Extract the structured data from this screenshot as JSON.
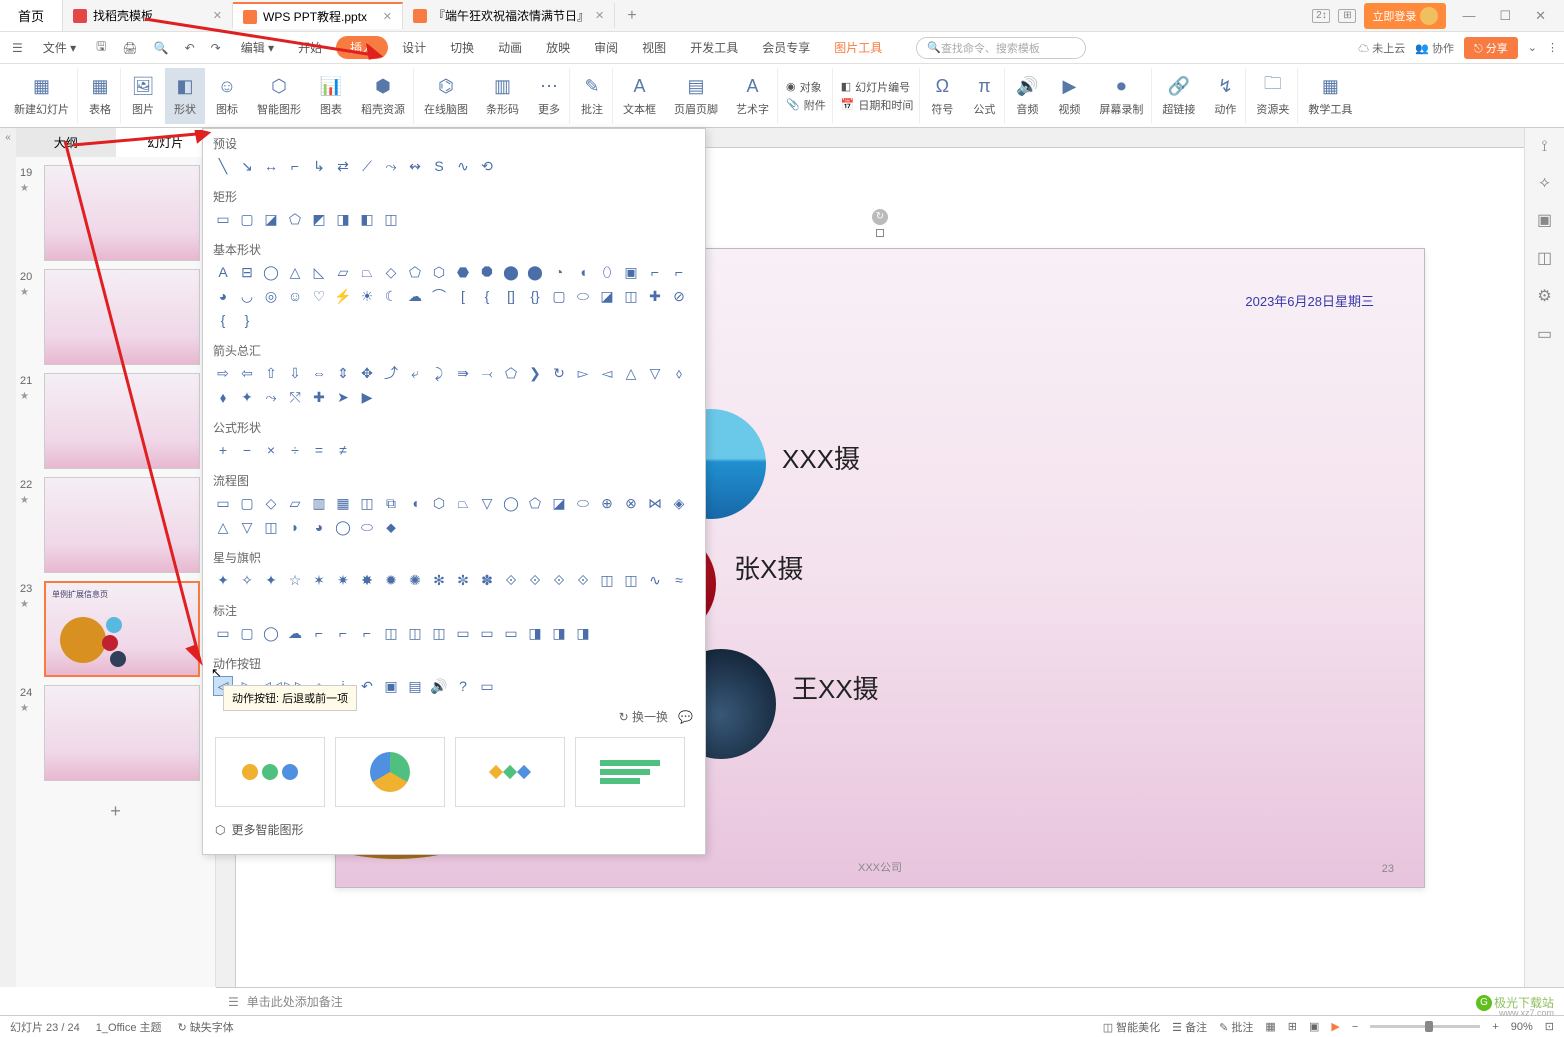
{
  "titlebar": {
    "home": "首页",
    "tabs": [
      {
        "label": "找稻壳模板",
        "color": "red"
      },
      {
        "label": "WPS PPT教程.pptx",
        "color": "orange",
        "active": true
      },
      {
        "label": "『端午狂欢祝福浓情满节日』",
        "color": "orange"
      }
    ],
    "login": "立即登录"
  },
  "menubar": {
    "file": "文件",
    "edit": "编辑",
    "items": [
      "开始",
      "插入",
      "设计",
      "切换",
      "动画",
      "放映",
      "审阅",
      "视图",
      "开发工具",
      "会员专享",
      "图片工具"
    ],
    "active": "插入",
    "search_placeholder": "查找命令、搜索模板",
    "cloud": "未上云",
    "collab": "协作",
    "share": "分享"
  },
  "ribbon": {
    "new_slide": "新建幻灯片",
    "table": "表格",
    "image": "图片",
    "shape": "形状",
    "icon": "图标",
    "smartart": "智能图形",
    "chart": "图表",
    "resource": "稻壳资源",
    "mindmap": "在线脑图",
    "barcode": "条形码",
    "more": "更多",
    "comment": "批注",
    "textbox": "文本框",
    "header_footer": "页眉页脚",
    "wordart": "艺术字",
    "object": "对象",
    "attach": "附件",
    "slide_num": "幻灯片编号",
    "datetime": "日期和时间",
    "symbol": "符号",
    "formula": "公式",
    "audio": "音频",
    "video": "视频",
    "screenrec": "屏幕录制",
    "hyperlink": "超链接",
    "action": "动作",
    "package": "资源夹",
    "teaching": "教学工具"
  },
  "sidebar": {
    "tab_outline": "大纲",
    "tab_slides": "幻灯片",
    "slides": [
      {
        "n": "19"
      },
      {
        "n": "20"
      },
      {
        "n": "21"
      },
      {
        "n": "22"
      },
      {
        "n": "23",
        "selected": true,
        "title": "单例扩展信息页"
      },
      {
        "n": "24"
      }
    ]
  },
  "shapes": {
    "sec_preset": "预设",
    "sec_rect": "矩形",
    "sec_basic": "基本形状",
    "sec_arrows": "箭头总汇",
    "sec_formula": "公式形状",
    "sec_flowchart": "流程图",
    "sec_stars": "星与旗帜",
    "sec_callout": "标注",
    "sec_action": "动作按钮",
    "tooltip": "动作按钮: 后退或前一项",
    "refresh": "换一换",
    "more_smart": "更多智能图形"
  },
  "slide": {
    "date": "2023年6月28日星期三",
    "company": "XXX公司",
    "page": "23",
    "label1": "XXX摄",
    "label2": "张X摄",
    "label3": "王XX摄"
  },
  "notes": "单击此处添加备注",
  "status": {
    "slide_count": "幻灯片 23 / 24",
    "theme": "1_Office 主题",
    "missing_font": "缺失字体",
    "beautify": "智能美化",
    "notes": "备注",
    "comments": "批注",
    "zoom": "90%"
  },
  "watermark": "极光下载站",
  "watermark_url": "www.xz7.com"
}
